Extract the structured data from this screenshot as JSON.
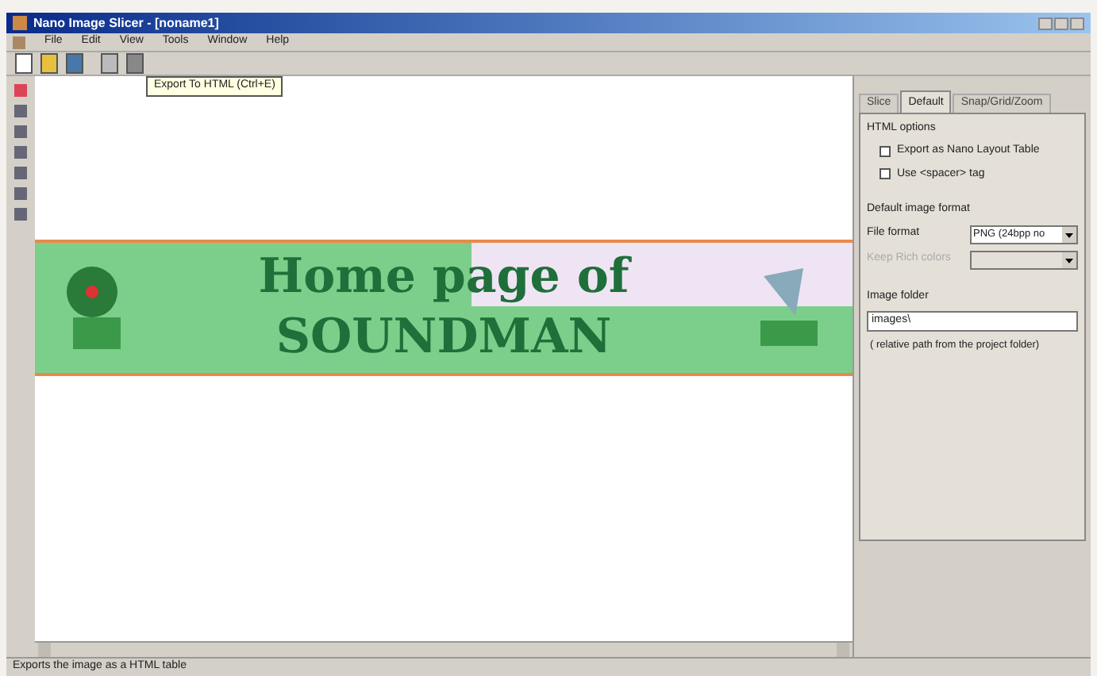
{
  "window": {
    "title": "Nano Image Slicer - [noname1]"
  },
  "menu": [
    "File",
    "Edit",
    "View",
    "Tools",
    "Window",
    "Help"
  ],
  "tooltip": "Export To HTML (Ctrl+E)",
  "banner": {
    "lines": [
      "Home page of",
      "SOUNDMAN"
    ]
  },
  "panel": {
    "tabs": [
      {
        "label": "Slice",
        "selected": false
      },
      {
        "label": "Default",
        "selected": true
      },
      {
        "label": "Snap/Grid/Zoom",
        "selected": false
      }
    ],
    "html_options": {
      "title": "HTML options",
      "checkboxes": [
        {
          "label": "Export as Nano Layout Table",
          "checked": false
        },
        {
          "label": "Use <spacer> tag",
          "checked": false
        }
      ]
    },
    "image_format": {
      "title": "Default image format",
      "fields": [
        {
          "label": "File format",
          "value": "PNG (24bpp no",
          "disabled": false
        },
        {
          "label": "Keep Rich colors",
          "disabled": true
        }
      ]
    },
    "image_folder": {
      "title": "Image folder",
      "value": "images\\",
      "hint": "( relative path from the project folder)"
    }
  },
  "status_bar": "Exports the image as a HTML table"
}
